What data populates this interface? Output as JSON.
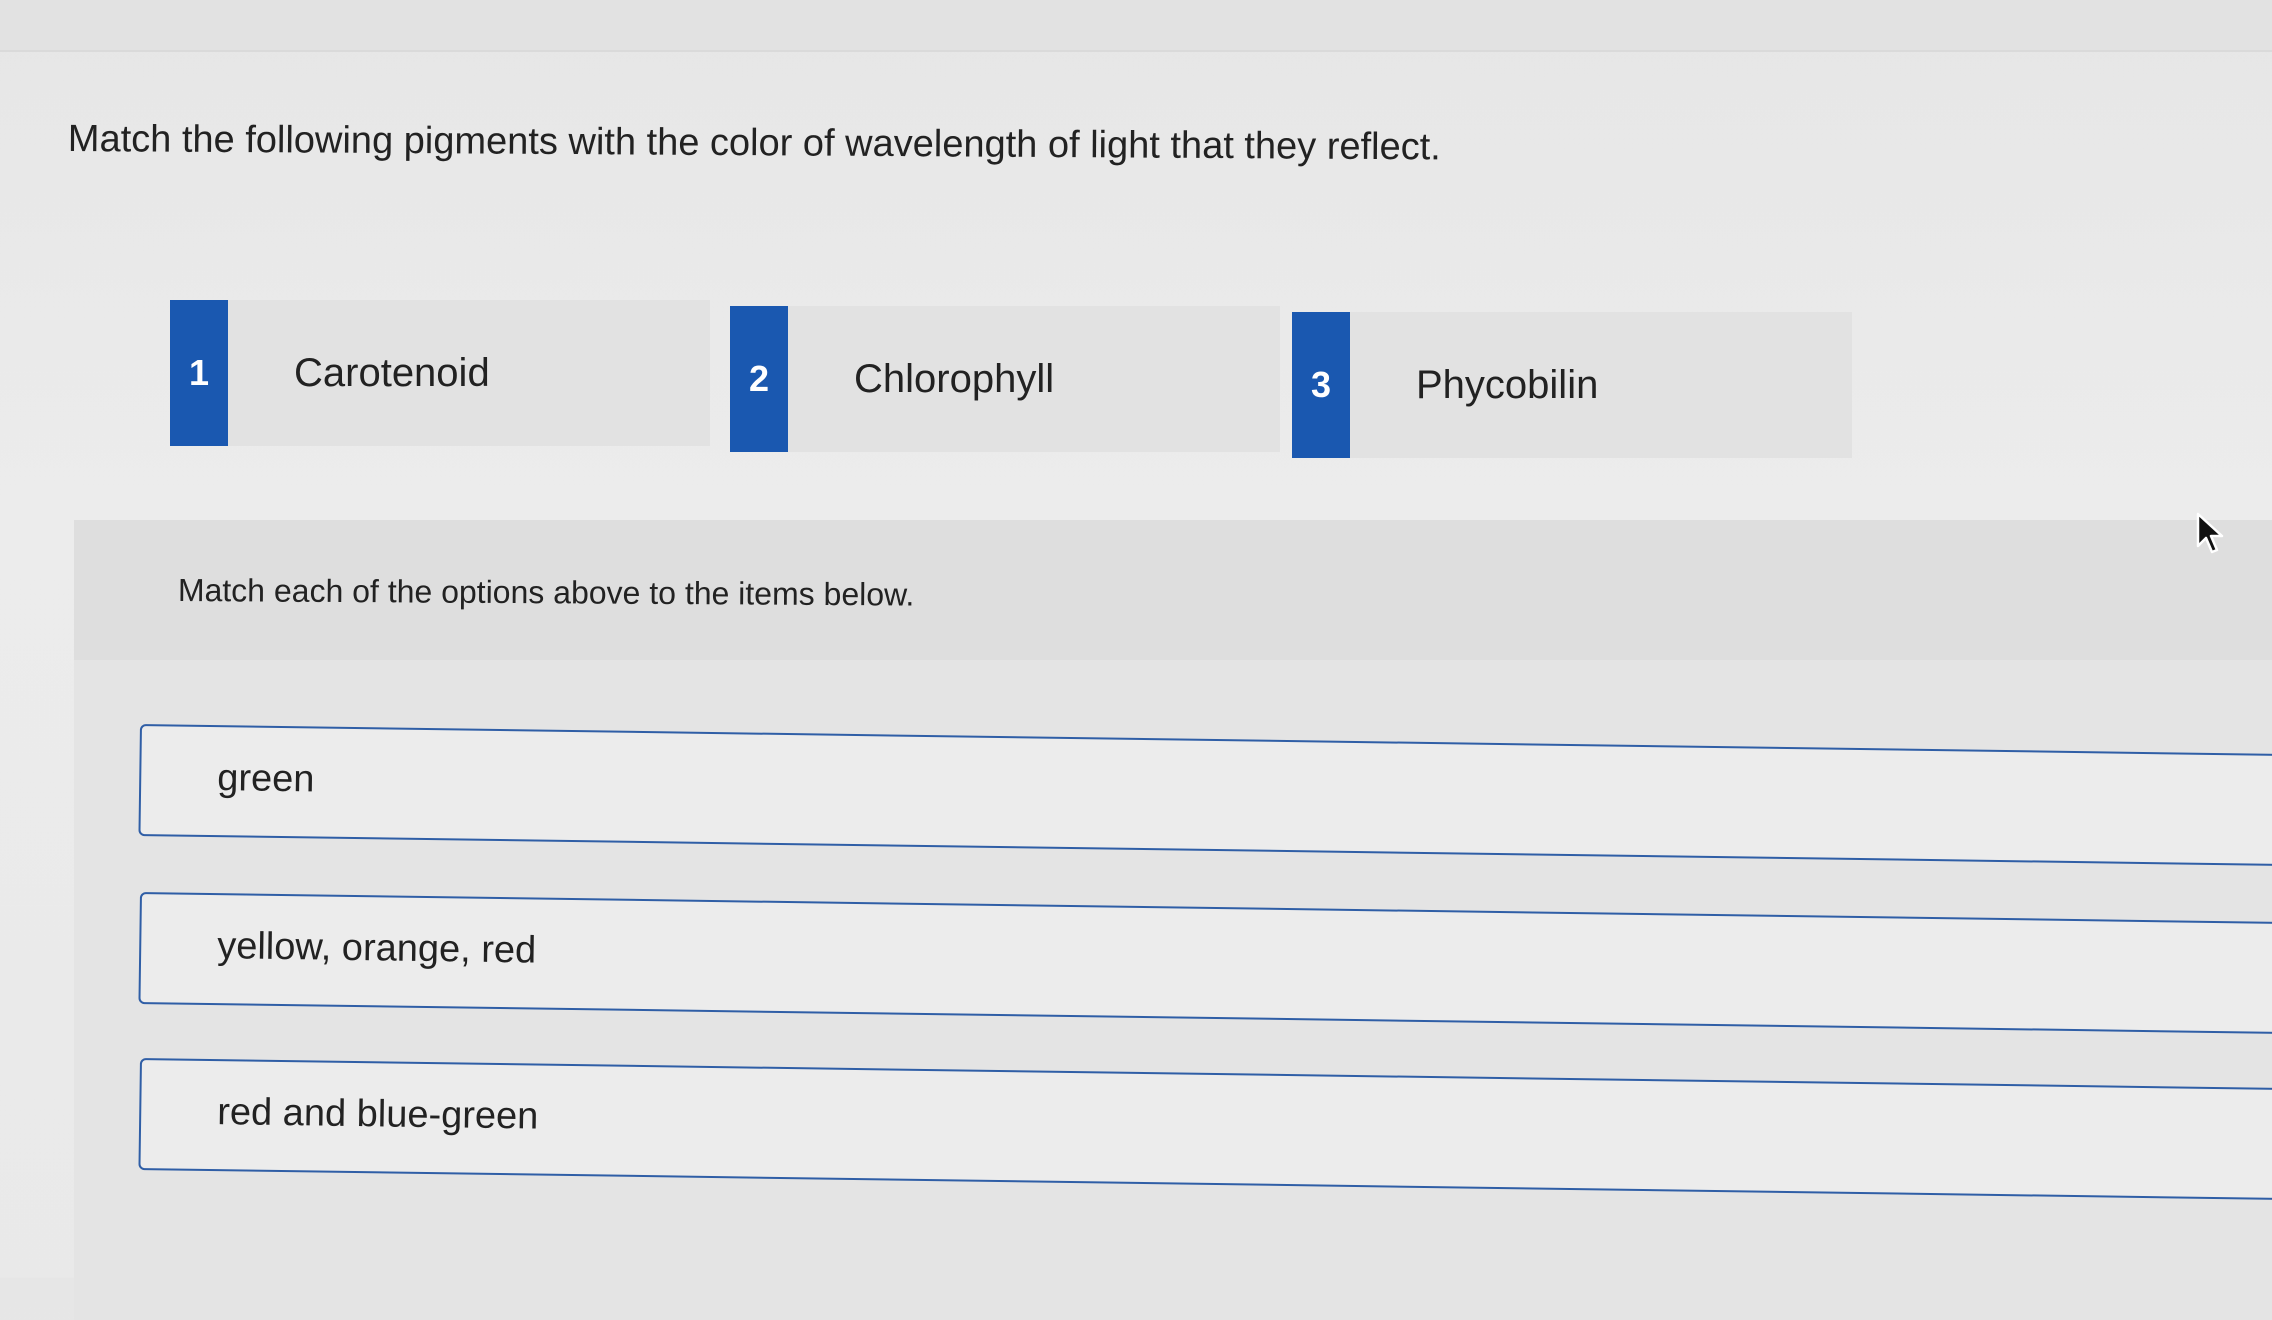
{
  "question": "Match the following pigments with the color of wavelength of light that they reflect.",
  "options": [
    {
      "number": "1",
      "label": "Carotenoid"
    },
    {
      "number": "2",
      "label": "Chlorophyll"
    },
    {
      "number": "3",
      "label": "Phycobilin"
    }
  ],
  "instruction": "Match each of the options above to the items below.",
  "targets": [
    {
      "label": "green"
    },
    {
      "label": "yellow, orange, red"
    },
    {
      "label": "red and blue-green"
    }
  ],
  "colors": {
    "badge": "#1a58b0",
    "target_border": "#2f5ea6",
    "background": "#e9e9e9"
  },
  "icons": {
    "cursor": "mouse-pointer-icon"
  }
}
